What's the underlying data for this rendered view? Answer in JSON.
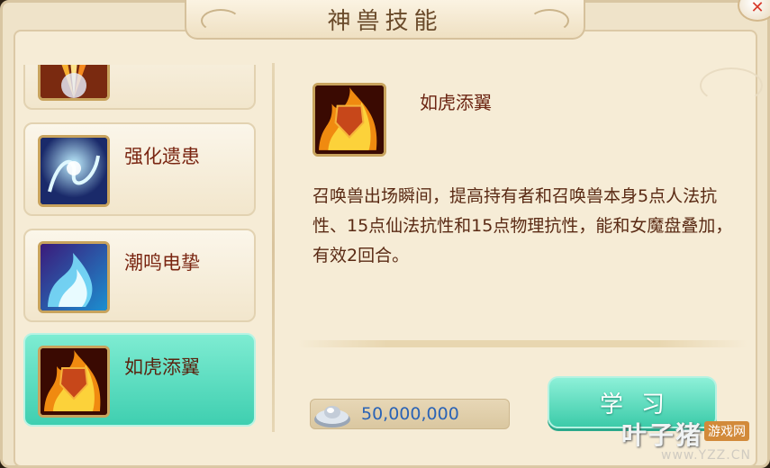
{
  "window": {
    "title": "神兽技能",
    "close_icon": "close-icon"
  },
  "skills": [
    {
      "label": "",
      "icon": "fire-rays-icon",
      "partial": true
    },
    {
      "label": "强化遗患",
      "icon": "blue-spirit-icon"
    },
    {
      "label": "潮鸣电挚",
      "icon": "wave-flame-icon"
    },
    {
      "label": "如虎添翼",
      "icon": "tiger-flame-icon",
      "selected": true
    }
  ],
  "detail": {
    "name": "如虎添翼",
    "icon": "tiger-flame-icon",
    "description": "召唤兽出场瞬间，提高持有者和召唤兽本身5点人法抗性、15点仙法抗性和15点物理抗性，能和女魔盘叠加，有效2回合。"
  },
  "cost": {
    "icon": "silver-ingot-icon",
    "value": "50,000,000"
  },
  "actions": {
    "learn_label": "学习"
  },
  "watermark": {
    "main": "叶子猪",
    "sub": "游戏网",
    "url": "www.YZZ.CN"
  },
  "colors": {
    "accent_teal": "#3fcfb0",
    "title_brown": "#6a4a2a",
    "skill_name": "#7a2612",
    "cost_blue": "#2a63b6"
  }
}
